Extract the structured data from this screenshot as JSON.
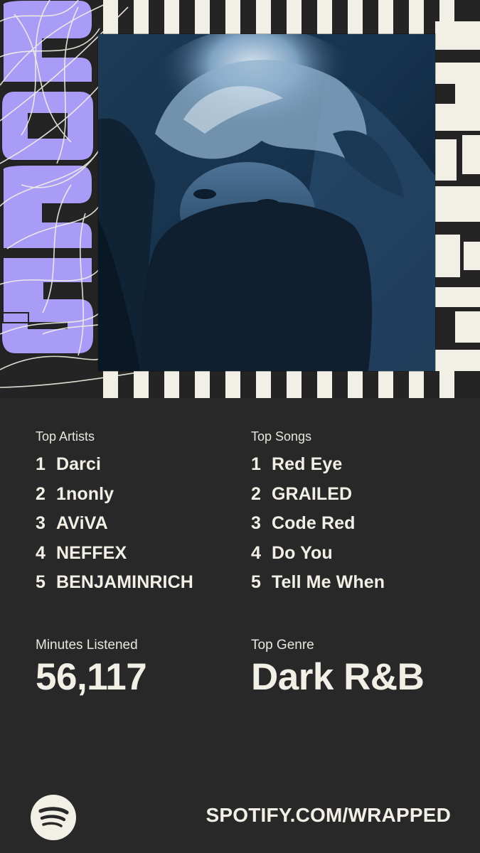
{
  "year_badge": "2025",
  "top_artists": {
    "title": "Top Artists",
    "items": [
      {
        "rank": "1",
        "name": "Darci"
      },
      {
        "rank": "2",
        "name": "1nonly"
      },
      {
        "rank": "3",
        "name": "AViVA"
      },
      {
        "rank": "4",
        "name": "NEFFEX"
      },
      {
        "rank": "5",
        "name": "BENJAMINRICH"
      }
    ]
  },
  "top_songs": {
    "title": "Top Songs",
    "items": [
      {
        "rank": "1",
        "name": "Red Eye"
      },
      {
        "rank": "2",
        "name": "GRAILED"
      },
      {
        "rank": "3",
        "name": "Code Red"
      },
      {
        "rank": "4",
        "name": "Do You"
      },
      {
        "rank": "5",
        "name": "Tell Me When"
      }
    ]
  },
  "minutes": {
    "label": "Minutes Listened",
    "value": "56,117"
  },
  "genre": {
    "label": "Top Genre",
    "value": "Dark R&B"
  },
  "footer": {
    "url": "SPOTIFY.COM/WRAPPED",
    "logo_icon": "spotify-logo-icon"
  },
  "colors": {
    "background": "#282828",
    "text": "#f2f0e6",
    "accent_purple": "#a89cf7",
    "photo_tint": "#234766"
  }
}
